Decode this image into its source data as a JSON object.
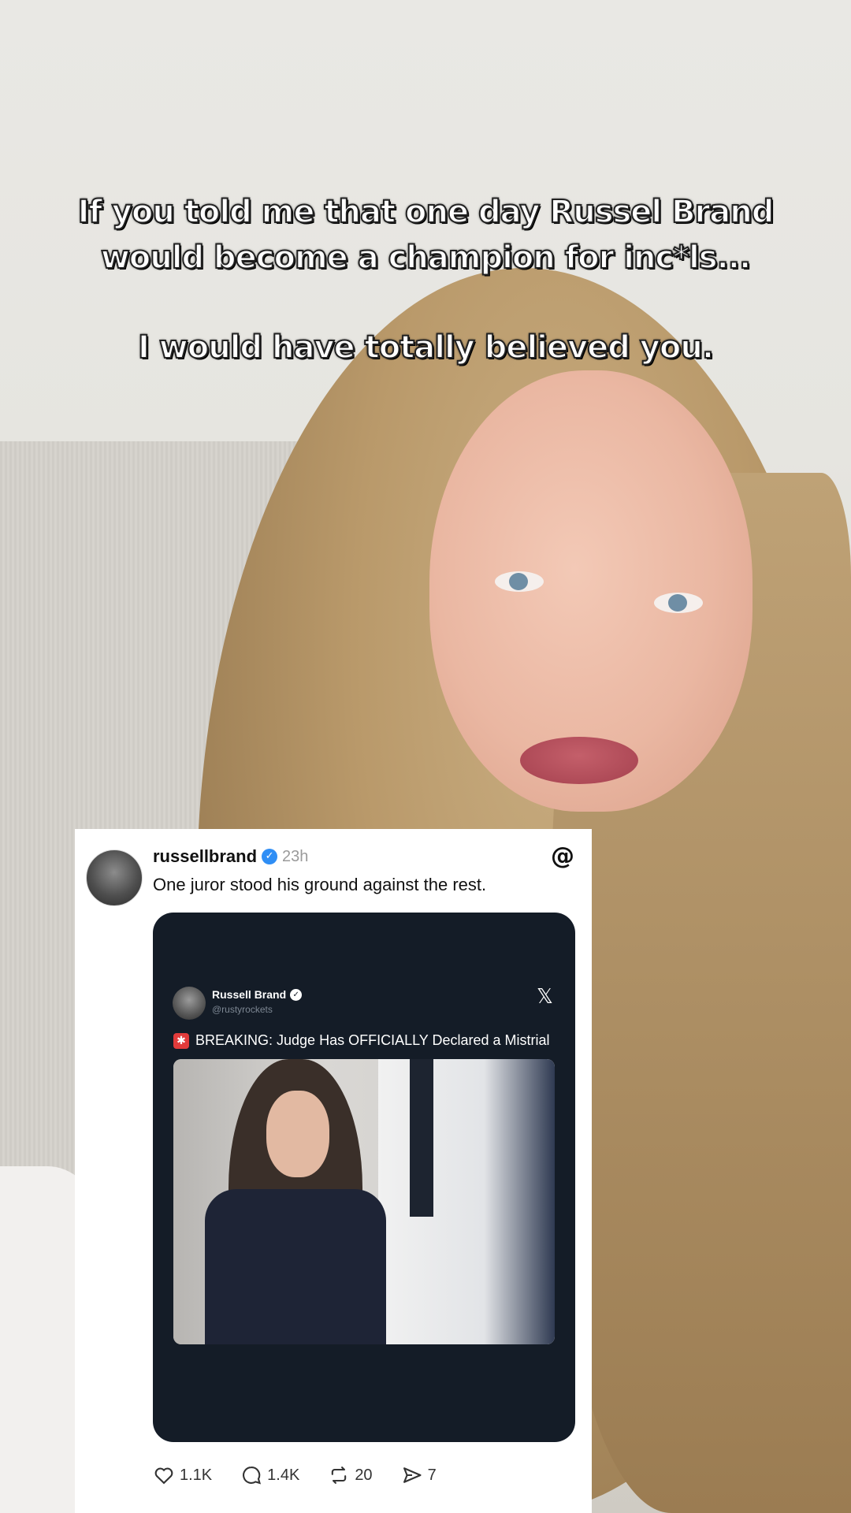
{
  "caption": {
    "line1": "If you told me that one day Russel Brand",
    "line2": "would become a champion for inc*ls...",
    "line3": "I would have totally believed you."
  },
  "post": {
    "username": "russellbrand",
    "time": "23h",
    "text": "One juror stood his ground against the rest.",
    "embed": {
      "name": "Russell Brand",
      "handle": "@rustyrockets",
      "text": "BREAKING: Judge Has OFFICIALLY Declared a Mistrial"
    },
    "stats": {
      "likes": "1.1K",
      "replies": "1.4K",
      "reposts": "20",
      "shares": "7"
    }
  },
  "icons": {
    "verified": "verified-check-icon",
    "threads": "threads-logo-icon",
    "x": "x-logo-icon",
    "siren": "siren-icon",
    "like": "heart-icon",
    "reply": "comment-icon",
    "repost": "repost-icon",
    "share": "send-icon"
  },
  "colors": {
    "verified": "#2f8ef5",
    "embed_bg": "#141c27"
  }
}
